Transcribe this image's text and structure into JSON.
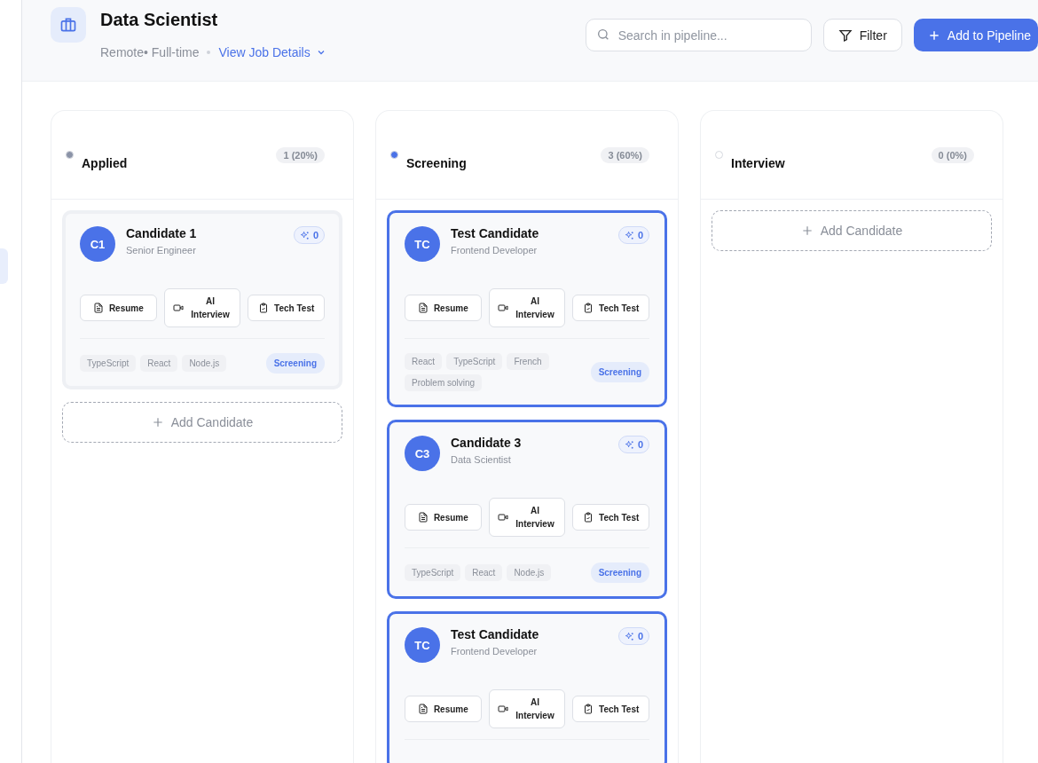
{
  "job": {
    "title": "Data Scientist",
    "meta": "Remote• Full-time",
    "details_link": "View Job Details"
  },
  "search": {
    "placeholder": "Search in pipeline..."
  },
  "filter_button": "Filter",
  "add_button": "Add to Pipeline",
  "sidebar": {
    "items": [
      {
        "selected": true
      }
    ]
  },
  "columns": [
    {
      "title": "Applied",
      "color": "#8b93a7",
      "count": "1 (20%)",
      "add_label": "Add Candidate",
      "cards": [
        {
          "initials": "C1",
          "name": "Candidate 1",
          "role": "Senior Engineer",
          "score": "0",
          "selected": false,
          "actions": [
            "Resume",
            "AI Interview",
            "Tech Test"
          ],
          "tags": [
            "TypeScript",
            "React",
            "Node.js"
          ],
          "status": "Screening"
        }
      ]
    },
    {
      "title": "Screening",
      "color": "#4a72e8",
      "count": "3 (60%)",
      "cards": [
        {
          "initials": "TC",
          "name": "Test Candidate",
          "role": "Frontend Developer",
          "score": "0",
          "selected": true,
          "actions": [
            "Resume",
            "AI Interview",
            "Tech Test"
          ],
          "tags": [
            "React",
            "TypeScript",
            "French",
            "Problem solving"
          ],
          "status": "Screening"
        },
        {
          "initials": "C3",
          "name": "Candidate 3",
          "role": "Data Scientist",
          "score": "0",
          "selected": true,
          "actions": [
            "Resume",
            "AI Interview",
            "Tech Test"
          ],
          "tags": [
            "TypeScript",
            "React",
            "Node.js"
          ],
          "status": "Screening"
        },
        {
          "initials": "TC",
          "name": "Test Candidate",
          "role": "Frontend Developer",
          "score": "0",
          "selected": true,
          "actions": [
            "Resume",
            "AI Interview",
            "Tech Test"
          ]
        }
      ]
    },
    {
      "title": "Interview",
      "color": "#ffffff",
      "count": "0 (0%)",
      "add_label": "Add Candidate"
    }
  ]
}
